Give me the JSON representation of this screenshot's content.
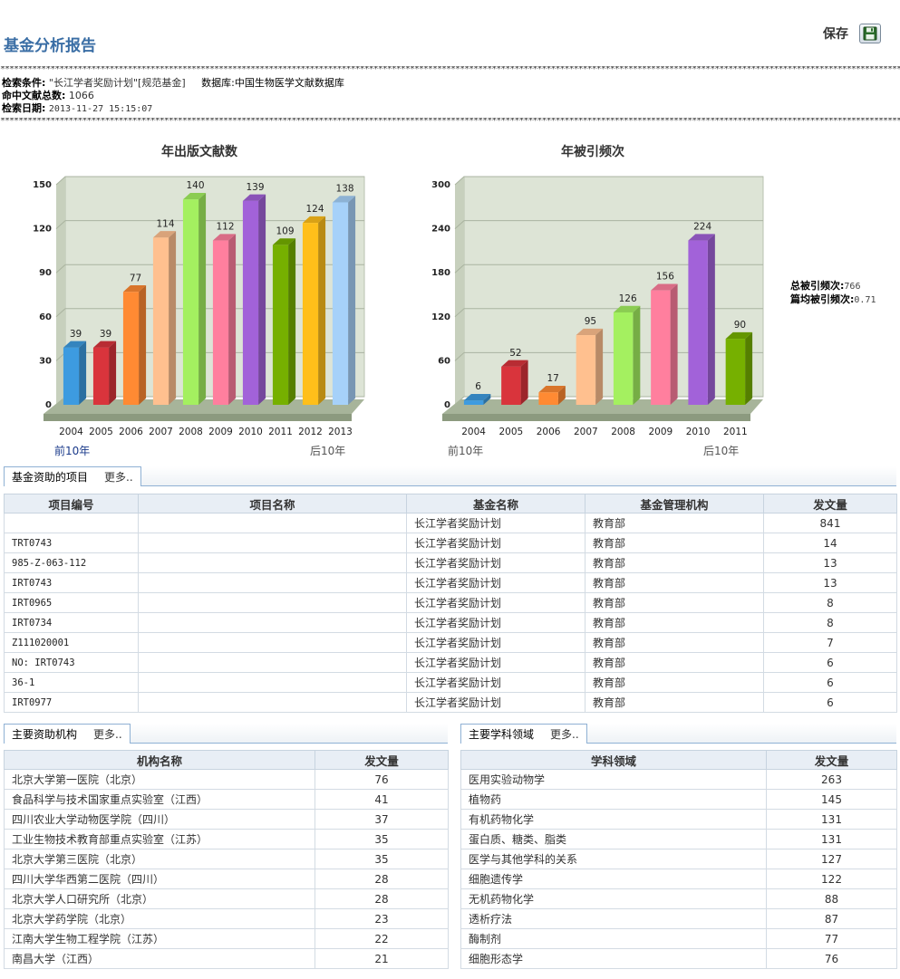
{
  "page": {
    "title": "基金分析报告",
    "save_label": "保存",
    "separator": "*************************************************************************************************************************************************************************************************************************"
  },
  "search_info": {
    "condition_label": "检索条件:",
    "condition_value": "\"长江学者奖励计划\"[规范基金]",
    "database_label": "数据库:",
    "database_value": "中国生物医学文献数据库",
    "hits_label": "命中文献总数:",
    "hits_value": "1066",
    "date_label": "检索日期:",
    "date_value": "2013-11-27 15:15:07"
  },
  "colors": [
    "#3d9be0",
    "#d9343c",
    "#ff8a33",
    "#ffc08f",
    "#a4f060",
    "#ff7f9e",
    "#a262d9",
    "#76b000",
    "#ffbf1a",
    "#a6d1f9"
  ],
  "pager": {
    "prev": "前10年",
    "next": "后10年"
  },
  "chart_data": [
    {
      "type": "bar",
      "title": "年出版文献数",
      "categories": [
        "2004",
        "2005",
        "2006",
        "2007",
        "2008",
        "2009",
        "2010",
        "2011",
        "2012",
        "2013"
      ],
      "values": [
        39,
        39,
        77,
        114,
        140,
        112,
        139,
        109,
        124,
        138
      ],
      "ylim": [
        0,
        150
      ],
      "yticks": [
        "0",
        "30",
        "60",
        "90",
        "120",
        "150"
      ],
      "grid": true,
      "legend": "none"
    },
    {
      "type": "bar",
      "title": "年被引频次",
      "categories": [
        "2004",
        "2005",
        "2006",
        "2007",
        "2008",
        "2009",
        "2010",
        "2011"
      ],
      "values": [
        6,
        52,
        17,
        95,
        126,
        156,
        224,
        90
      ],
      "ylim": [
        0,
        300
      ],
      "yticks": [
        "0",
        "60",
        "120",
        "180",
        "240",
        "300"
      ],
      "grid": true,
      "legend": "none"
    }
  ],
  "citation_summary": {
    "total_label": "总被引频次:",
    "total_value": "766",
    "avg_label": "篇均被引频次:",
    "avg_value": "0.71"
  },
  "funded_projects": {
    "tab": "基金资助的项目",
    "more": "更多..",
    "headers": [
      "项目编号",
      "项目名称",
      "基金名称",
      "基金管理机构",
      "发文量"
    ],
    "rows": [
      [
        "",
        "",
        "长江学者奖励计划",
        "教育部",
        "841"
      ],
      [
        "TRT0743",
        "",
        "长江学者奖励计划",
        "教育部",
        "14"
      ],
      [
        "985-Z-063-112",
        "",
        "长江学者奖励计划",
        "教育部",
        "13"
      ],
      [
        "IRT0743",
        "",
        "长江学者奖励计划",
        "教育部",
        "13"
      ],
      [
        "IRT0965",
        "",
        "长江学者奖励计划",
        "教育部",
        "8"
      ],
      [
        "IRT0734",
        "",
        "长江学者奖励计划",
        "教育部",
        "8"
      ],
      [
        "Z111020001",
        "",
        "长江学者奖励计划",
        "教育部",
        "7"
      ],
      [
        "NO: IRT0743",
        "",
        "长江学者奖励计划",
        "教育部",
        "6"
      ],
      [
        "36-1",
        "",
        "长江学者奖励计划",
        "教育部",
        "6"
      ],
      [
        "IRT0977",
        "",
        "长江学者奖励计划",
        "教育部",
        "6"
      ]
    ]
  },
  "institutions": {
    "tab": "主要资助机构",
    "more": "更多..",
    "headers": [
      "机构名称",
      "发文量"
    ],
    "rows": [
      [
        "北京大学第一医院（北京）",
        "76"
      ],
      [
        "食品科学与技术国家重点实验室（江西）",
        "41"
      ],
      [
        "四川农业大学动物医学院（四川）",
        "37"
      ],
      [
        "工业生物技术教育部重点实验室（江苏）",
        "35"
      ],
      [
        "北京大学第三医院（北京）",
        "35"
      ],
      [
        "四川大学华西第二医院（四川）",
        "28"
      ],
      [
        "北京大学人口研究所（北京）",
        "28"
      ],
      [
        "北京大学药学院（北京）",
        "23"
      ],
      [
        "江南大学生物工程学院（江苏）",
        "22"
      ],
      [
        "南昌大学（江西）",
        "21"
      ]
    ]
  },
  "subjects": {
    "tab": "主要学科领域",
    "more": "更多..",
    "headers": [
      "学科领域",
      "发文量"
    ],
    "rows": [
      [
        "医用实验动物学",
        "263"
      ],
      [
        "植物药",
        "145"
      ],
      [
        "有机药物化学",
        "131"
      ],
      [
        "蛋白质、糖类、脂类",
        "131"
      ],
      [
        "医学与其他学科的关系",
        "127"
      ],
      [
        "细胞遗传学",
        "122"
      ],
      [
        "无机药物化学",
        "88"
      ],
      [
        "透析疗法",
        "87"
      ],
      [
        "酶制剂",
        "77"
      ],
      [
        "细胞形态学",
        "76"
      ]
    ]
  }
}
